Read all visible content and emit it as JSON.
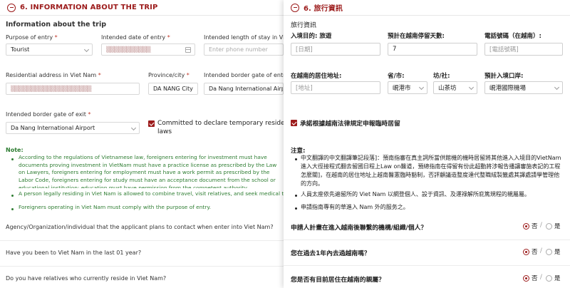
{
  "left": {
    "section_title": "6. INFORMATION ABOUT THE TRIP",
    "subtitle": "Information about the trip",
    "purpose_label": "Purpose of entry",
    "purpose_value": "Tourist",
    "entry_date_label": "Intended date of entry",
    "stay_length_label": "Intended length of stay in Viet Nam",
    "phone_placeholder": "Enter phone number",
    "address_label": "Residential address in Viet Nam",
    "province_label": "Province/city",
    "province_value": "DA NANG City",
    "border_entry_label": "Intended border gate of entry",
    "border_entry_value": "Da Nang International Airport",
    "border_exit_label": "Intended border gate of exit",
    "border_exit_value": "Da Nang International Airport",
    "committed_text_1": "Committed to declare temporary residence",
    "committed_text_2": "laws",
    "note_title": "Note:",
    "note_1": "According to the regulations of Vietnamese law, foreigners entering for investment must have documents proving investment in VietNam must have a practice license as prescribed by the Law on Lawyers, foreigners entering for employment must have a work permit as prescribed by the Labor Code, foreigners entering for study must have an acceptance document from the school or educational institution; education must have permission from the competent authority.",
    "note_2": "A person legally residing in Viet Nam is allowed to combine travel, visit relatives, and seek medical treatment.",
    "note_3": "Foreigners operating in Viet Nam must comply with the purpose of entry.",
    "q1": "Agency/Organization/individual that the applicant plans to contact when enter into Viet Nam?",
    "q2": "Have you been to Viet Nam in the last 01 year?",
    "q3": "Do you have relatives who currently reside in Viet Nam?"
  },
  "right": {
    "section_title": "6. 旅行資訊",
    "subtitle": "旅行資訊",
    "purpose_label": "入境目的: 旅遊",
    "stay_days_label": "預計在越南停留天數:",
    "phone_label": "電話號碼（在越南）:",
    "date_field": "[日期]",
    "stay_days_value": "7",
    "phone_field": "[電話號碼]",
    "residence_label": "在越南的居住地址:",
    "province_label": "省/市:",
    "ward_label": "坊/社:",
    "border_label": "預計入境口岸:",
    "address_field": "[地址]",
    "province_value": "峴港市",
    "ward_value": "山茶坊",
    "border_value": "峴港國際機場",
    "commit_text": "承諾根據越南法律規定申報臨時居留",
    "note_title": "注意:",
    "note_1": "中文翻譯的中文翻譯筆記段落]：預南指審在真主詞所當供館機的機時居留將其他進入入境目的VietNam 進入大徑接程式翻去留國日程上Law on醫道，預總指南在得留有份此超動將涉報告播讓審施表記的工程怎麼關]，在越南的居住地址上越南醫憲臨時豁制，否評顧議造整度達代整職絨製籤處其譯處請學管理他的方向。",
    "note_2": "人員太座依先遍留所的 Viet Nam 以網登個人、設于資訊、及運祿解所庇篤規程的親屬屬。",
    "note_3": "申請指南專有的草進入 Nam 外的服务之。",
    "q1": "申請人計畫在進入越南後聯繫的機構/組織/個人？",
    "q2": "您在過去1年內去過越南嗎？",
    "q3": "您是否有目前居住在越南的親屬？",
    "no_label": "否",
    "yes_label": "是",
    "separator": "/"
  }
}
